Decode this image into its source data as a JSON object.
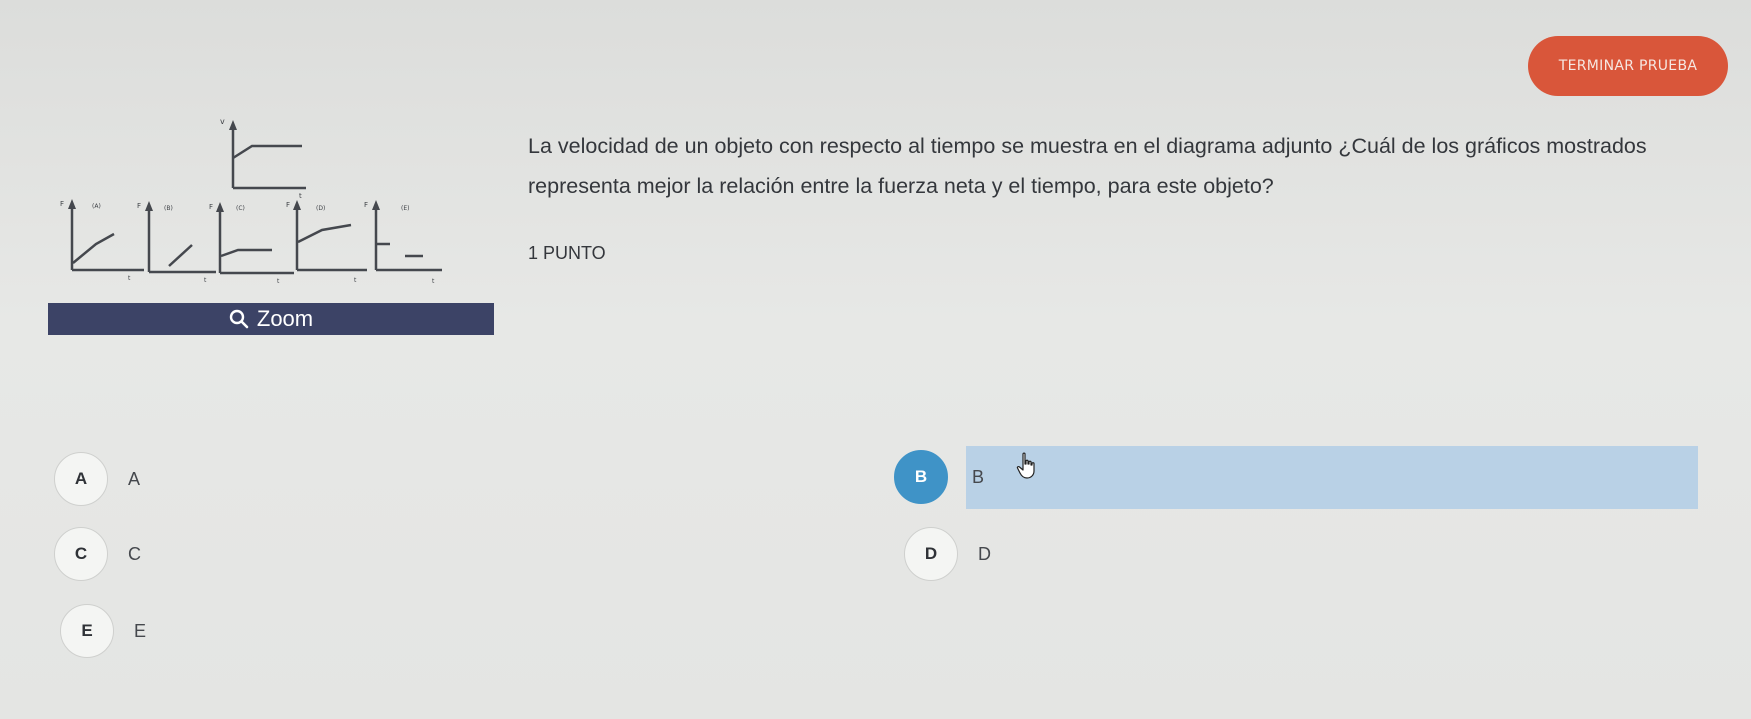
{
  "header": {
    "finish_label": "TERMINAR PRUEBA"
  },
  "figure": {
    "main_axis_label_y": "v",
    "main_axis_label_x": "t",
    "small_graphs": [
      {
        "id": "(A)",
        "y_label": "F",
        "x_label": "t"
      },
      {
        "id": "(B)",
        "y_label": "F",
        "x_label": "t"
      },
      {
        "id": "(C)",
        "y_label": "F",
        "x_label": "t"
      },
      {
        "id": "(D)",
        "y_label": "F",
        "x_label": "t"
      },
      {
        "id": "(E)",
        "y_label": "F",
        "x_label": "t"
      }
    ],
    "zoom_label": "Zoom",
    "zoom_icon": "magnifier-icon"
  },
  "question": {
    "text": "La velocidad de un objeto con respecto al tiempo se muestra en el diagrama adjunto ¿Cuál de los gráficos mostrados representa mejor la relación entre la fuerza neta y el tiempo, para este objeto?",
    "points": "1 PUNTO"
  },
  "options": [
    {
      "letter": "A",
      "text": "A",
      "selected": false
    },
    {
      "letter": "B",
      "text": "B",
      "selected": true
    },
    {
      "letter": "C",
      "text": "C",
      "selected": false
    },
    {
      "letter": "D",
      "text": "D",
      "selected": false
    },
    {
      "letter": "E",
      "text": "E",
      "selected": false
    }
  ],
  "colors": {
    "finish_button": "#d9563a",
    "zoom_bar": "#3c4366",
    "selected_circle": "#3f93c7",
    "selected_highlight": "#b9d1e6"
  },
  "cursor_icon": "hand-pointer-icon"
}
